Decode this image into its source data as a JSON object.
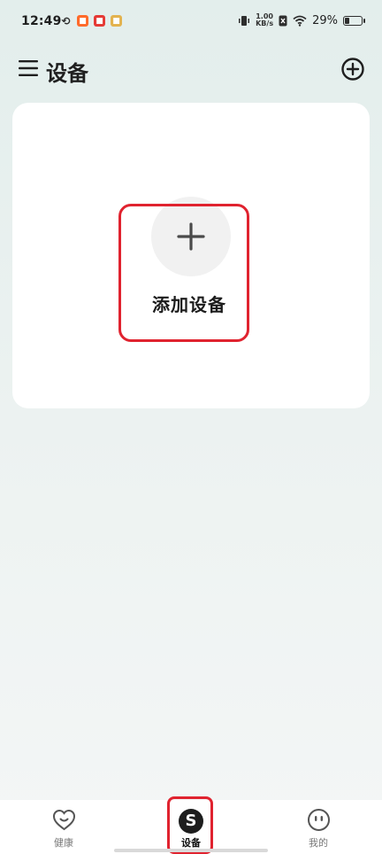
{
  "status_bar": {
    "time": "12:49",
    "network_speed_value": "1.00",
    "network_speed_unit": "KB/s",
    "battery_percent": "29%",
    "battery_level": 0.29
  },
  "header": {
    "title": "设备"
  },
  "card": {
    "add_device_label": "添加设备"
  },
  "bottom_nav": {
    "items": [
      {
        "label": "健康",
        "icon": "heart-smile-icon",
        "active": false
      },
      {
        "label": "设备",
        "icon": "device-s-icon",
        "active": true,
        "icon_text": "S"
      },
      {
        "label": "我的",
        "icon": "face-icon",
        "active": false
      }
    ]
  },
  "colors": {
    "highlight": "#e0232f",
    "background_top": "#e3eeec",
    "card": "#ffffff"
  }
}
